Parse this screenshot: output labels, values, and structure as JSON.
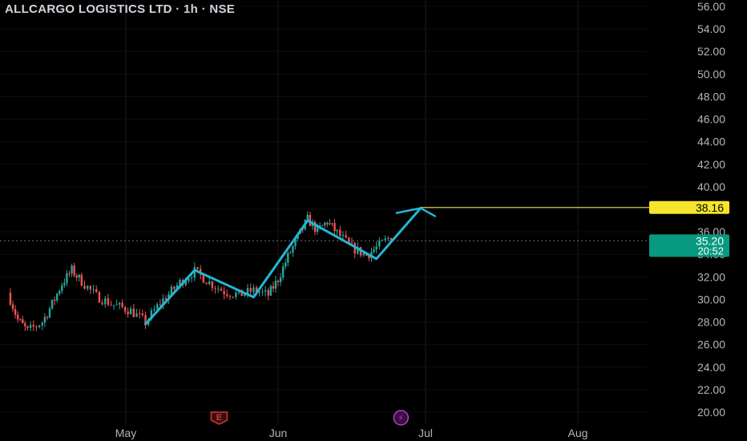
{
  "header": {
    "title": "ALLCARGO LOGISTICS LTD · 1h · NSE"
  },
  "colors": {
    "background": "#000000",
    "up_candle": "#26a69a",
    "down_candle": "#ef5350",
    "pattern_line": "#22b6d4",
    "target_line": "#d4cf4a",
    "target_badge": "#f5e52c",
    "price_badge": "#089981",
    "axis_text": "#b2b5be",
    "grid": "#1c1c1c",
    "events_earnings": "#d23a3a",
    "events_dividend": "#b33cc9"
  },
  "chart_data": {
    "type": "candlestick",
    "title": "ALLCARGO LOGISTICS LTD · 1h · NSE",
    "symbol": "ALLCARGO",
    "interval": "1h",
    "exchange": "NSE",
    "y_axis": {
      "min": 20,
      "max": 56,
      "ticks": [
        "56.00",
        "54.00",
        "52.00",
        "50.00",
        "48.00",
        "46.00",
        "44.00",
        "42.00",
        "40.00",
        "38.00",
        "36.00",
        "34.00",
        "32.00",
        "30.00",
        "28.00",
        "26.00",
        "24.00",
        "22.00",
        "20.00"
      ]
    },
    "x_axis": {
      "labels": [
        "May",
        "Jun",
        "Jul",
        "Aug"
      ]
    },
    "grid": true,
    "price_path": [
      {
        "date": "2025-04-07",
        "price": 30.6
      },
      {
        "date": "2025-04-09",
        "price": 28.2
      },
      {
        "date": "2025-04-11",
        "price": 27.2
      },
      {
        "date": "2025-04-14",
        "price": 28.0
      },
      {
        "date": "2025-04-16",
        "price": 29.6
      },
      {
        "date": "2025-04-18",
        "price": 31.4
      },
      {
        "date": "2025-04-20",
        "price": 32.6
      },
      {
        "date": "2025-04-22",
        "price": 31.6
      },
      {
        "date": "2025-04-25",
        "price": 30.3
      },
      {
        "date": "2025-04-28",
        "price": 29.6
      },
      {
        "date": "2025-05-02",
        "price": 29.0
      },
      {
        "date": "2025-05-05",
        "price": 28.0
      },
      {
        "date": "2025-05-08",
        "price": 29.7
      },
      {
        "date": "2025-05-12",
        "price": 31.5
      },
      {
        "date": "2025-05-15",
        "price": 32.5
      },
      {
        "date": "2025-05-18",
        "price": 31.5
      },
      {
        "date": "2025-05-21",
        "price": 30.7
      },
      {
        "date": "2025-05-24",
        "price": 30.4
      },
      {
        "date": "2025-05-27",
        "price": 30.8
      },
      {
        "date": "2025-05-30",
        "price": 30.4
      },
      {
        "date": "2025-06-01",
        "price": 31.8
      },
      {
        "date": "2025-06-03",
        "price": 33.8
      },
      {
        "date": "2025-06-05",
        "price": 35.5
      },
      {
        "date": "2025-06-07",
        "price": 37.1
      },
      {
        "date": "2025-06-09",
        "price": 36.1
      },
      {
        "date": "2025-06-11",
        "price": 36.9
      },
      {
        "date": "2025-06-13",
        "price": 35.9
      },
      {
        "date": "2025-06-16",
        "price": 34.6
      },
      {
        "date": "2025-06-19",
        "price": 33.9
      },
      {
        "date": "2025-06-21",
        "price": 34.6
      },
      {
        "date": "2025-06-24",
        "price": 35.6
      }
    ],
    "pattern_line": [
      {
        "date": "2025-05-05",
        "price": 27.8
      },
      {
        "date": "2025-05-15",
        "price": 32.6
      },
      {
        "date": "2025-05-27",
        "price": 30.2
      },
      {
        "date": "2025-06-07",
        "price": 37.0
      },
      {
        "date": "2025-06-21",
        "price": 33.6
      },
      {
        "date": "2025-06-30",
        "price": 38.1
      }
    ],
    "target_line": {
      "price": 38.16,
      "label": "38.16",
      "from_date": "2025-06-30"
    },
    "last_price": {
      "price": 35.2,
      "label": "35.20",
      "countdown": "20:52"
    },
    "events": [
      {
        "type": "earnings",
        "label": "E",
        "date": "2025-05-20"
      },
      {
        "type": "dividend",
        "label": "⚡",
        "date": "2025-06-26"
      }
    ]
  }
}
